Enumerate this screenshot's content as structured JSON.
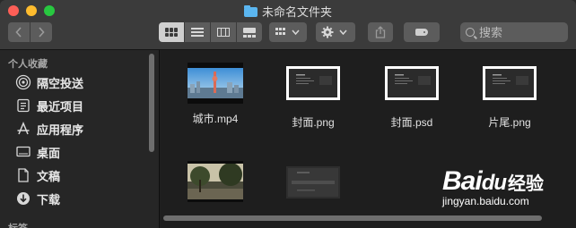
{
  "window": {
    "title": "未命名文件夹",
    "folder_icon": "folder-icon"
  },
  "toolbar": {
    "back_icon": "chevron-left-icon",
    "forward_icon": "chevron-right-icon",
    "view_modes": [
      "icon-view",
      "list-view",
      "column-view",
      "gallery-view"
    ],
    "selected_view": "icon-view",
    "search": {
      "placeholder": "搜索"
    }
  },
  "sidebar": {
    "heading_favorites": "个人收藏",
    "items": [
      {
        "label": "隔空投送",
        "icon": "airdrop-icon"
      },
      {
        "label": "最近项目",
        "icon": "recents-icon"
      },
      {
        "label": "应用程序",
        "icon": "applications-icon"
      },
      {
        "label": "桌面",
        "icon": "desktop-icon"
      },
      {
        "label": "文稿",
        "icon": "documents-icon"
      },
      {
        "label": "下载",
        "icon": "downloads-icon"
      }
    ],
    "heading_tags": "标签"
  },
  "files": [
    {
      "name": "城市.mp4",
      "kind": "video-thumbnail"
    },
    {
      "name": "封面.png",
      "kind": "image-thumbnail"
    },
    {
      "name": "封面.psd",
      "kind": "image-thumbnail"
    },
    {
      "name": "片尾.png",
      "kind": "image-thumbnail"
    },
    {
      "name": "",
      "kind": "video-thumbnail"
    },
    {
      "name": "",
      "kind": "image-thumbnail"
    }
  ],
  "watermark": {
    "logo": "Bai",
    "logo_paw": "du",
    "cn": "经验",
    "url": "jingyan.baidu.com"
  },
  "colors": {
    "accent": "#5bb6f0",
    "close": "#fe5f57",
    "minimize": "#febc2e",
    "zoom": "#28c840"
  }
}
